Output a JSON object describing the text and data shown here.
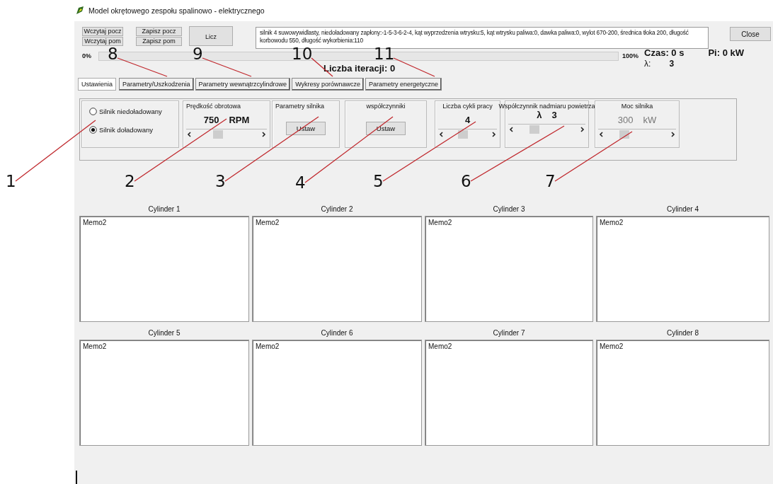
{
  "window": {
    "title": "Model okrętowego zespołu spalinowo - elektrycznego"
  },
  "file_buttons": [
    {
      "label": "Wczytaj pocz"
    },
    {
      "label": "Zapisz pocz"
    },
    {
      "label": "Wczytaj pom"
    },
    {
      "label": "Zapisz pom"
    }
  ],
  "compute_button": "Licz",
  "info_text": "silnik 4 suwowywidlasty, niedoładowany zapłony:-1-5-3-6-2-4, kąt wyprzedzenia wtrysku:5, kąt wtrysku paliwa:0, dawka paliwa:0, wylot 670-200, średnica tłoka 200, długość korbowodu 550, długość wykorbienia:110",
  "close_button": "Close",
  "progress": {
    "start_label": "0%",
    "end_label": "100%"
  },
  "iterations": "Liczba iteracji: 0",
  "time_label": "Czas: 0 s",
  "power_label": "Pi: 0 kW",
  "lambda": {
    "label": "λ:",
    "value": "3"
  },
  "tabs": [
    {
      "label": "Ustawienia",
      "selected": true
    },
    {
      "label": "Parametry/Uszkodzenia",
      "selected": false
    },
    {
      "label": "Parametry wewnątrzcylindrowe",
      "selected": false
    },
    {
      "label": "Wykresy porównawcze",
      "selected": false
    },
    {
      "label": "Parametry energetyczne",
      "selected": false
    }
  ],
  "engine_type": [
    {
      "label": "Silnik niedoładowany",
      "selected": false
    },
    {
      "label": "Silnik doładowany",
      "selected": true
    }
  ],
  "controls": [
    {
      "kind": "slider",
      "title": "Prędkość obrotowa",
      "value": "750",
      "unit": "RPM",
      "disabled": false
    },
    {
      "kind": "button",
      "title": "Parametry silnika",
      "button": "Ustaw",
      "disabled": false
    },
    {
      "kind": "button",
      "title": "współczynniki",
      "button": "Ustaw",
      "disabled": false
    },
    {
      "kind": "slider",
      "title": "Liczba cykli pracy",
      "value": "4",
      "disabled": false
    },
    {
      "kind": "slider",
      "title": "Współczynnik nadmiaru powietrza",
      "prefix": "λ",
      "value": "3",
      "disabled": false
    },
    {
      "kind": "slider",
      "title": "Moc silnika",
      "value": "300",
      "unit": "kW",
      "disabled": true
    }
  ],
  "cylinders": [
    {
      "title": "Cylinder 1",
      "text": "Memo2"
    },
    {
      "title": "Cylinder 2",
      "text": "Memo2"
    },
    {
      "title": "Cylinder 3",
      "text": "Memo2"
    },
    {
      "title": "Cylinder 4",
      "text": "Memo2"
    },
    {
      "title": "Cylinder 5",
      "text": "Memo2"
    },
    {
      "title": "Cylinder 6",
      "text": "Memo2"
    },
    {
      "title": "Cylinder 7",
      "text": "Memo2"
    },
    {
      "title": "Cylinder 8",
      "text": "Memo2"
    }
  ],
  "callouts": [
    "8",
    "9",
    "10",
    "11",
    "1",
    "2",
    "3",
    "4",
    "5",
    "6",
    "7"
  ]
}
